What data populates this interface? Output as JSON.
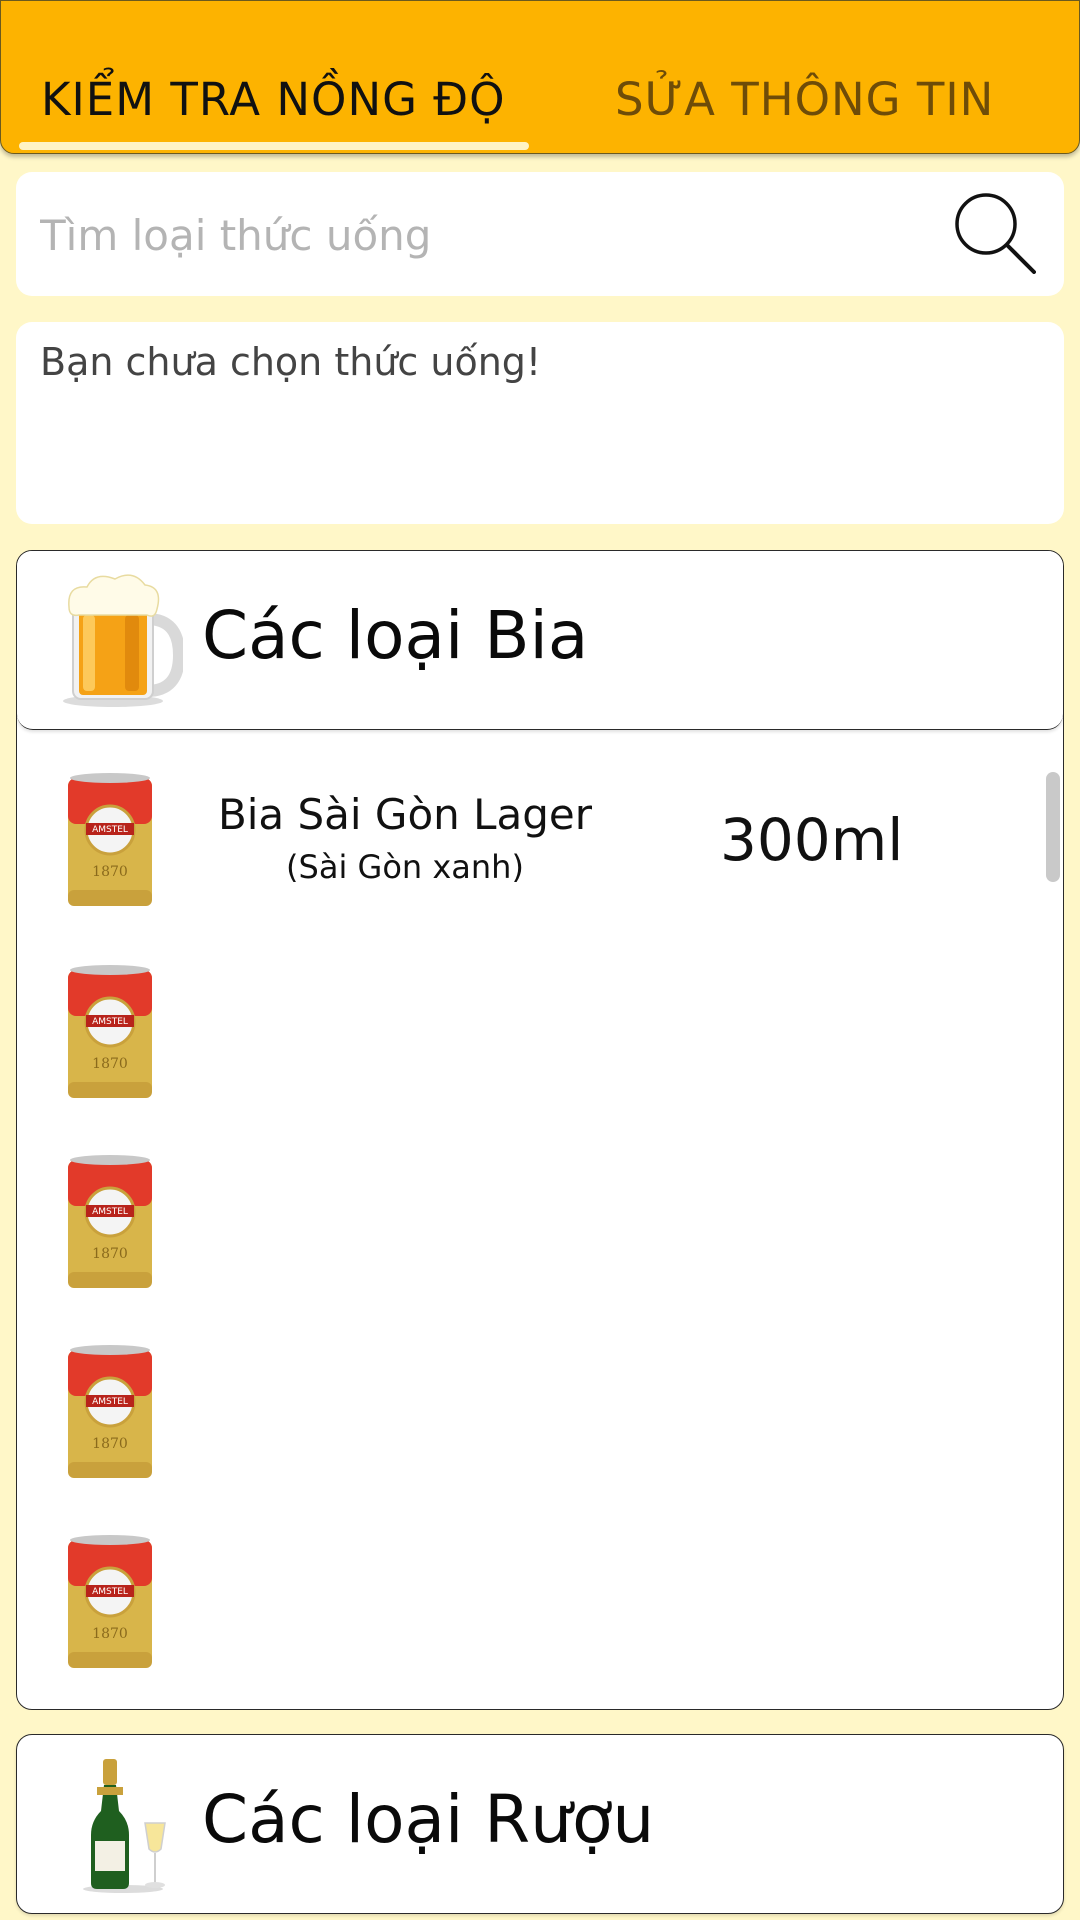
{
  "tabs": {
    "active_label": "KIỂM TRA NỒNG ĐỘ",
    "inactive_label": "SỬA THÔNG TIN"
  },
  "search": {
    "placeholder": "Tìm loại thức uống",
    "value": ""
  },
  "selection": {
    "message": "Bạn chưa chọn thức uống!"
  },
  "beer_section": {
    "title": "Các loại Bia",
    "icon": "beer-mug-icon",
    "items": [
      {
        "name": "Bia Sài Gòn Lager",
        "subname": "(Sài Gòn xanh)",
        "volume": "300ml",
        "icon": "beer-can-icon"
      }
    ]
  },
  "wine_section": {
    "title": "Các loại Rượu",
    "icon": "champagne-bottle-icon"
  },
  "colors": {
    "header": "#fdb300",
    "background": "#fff7c8",
    "panel": "#ffffff"
  }
}
